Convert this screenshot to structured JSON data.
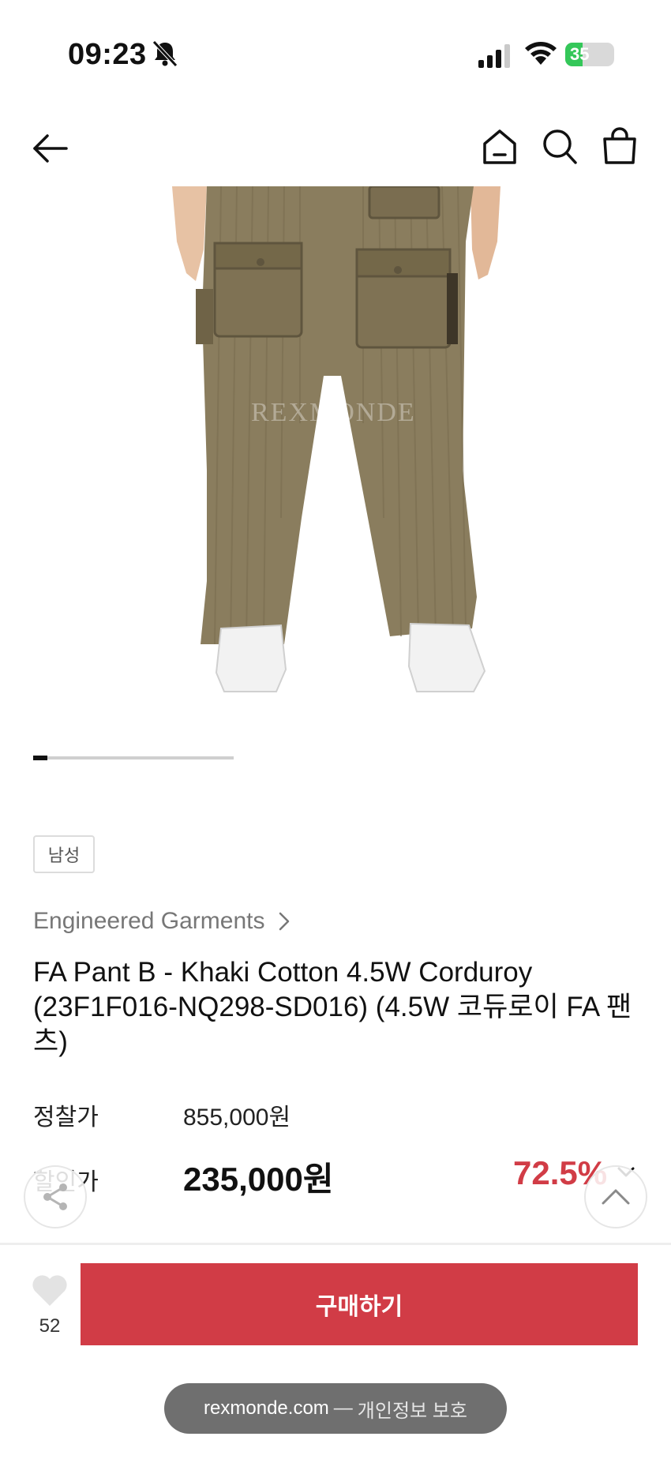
{
  "status_bar": {
    "time": "09:23",
    "battery_level": "35",
    "battery_fill_fraction": 0.35
  },
  "header": {
    "icons": [
      "back-arrow-icon",
      "home-icon",
      "search-icon",
      "shopping-bag-icon"
    ]
  },
  "product_image": {
    "watermark": "REXMONDE",
    "carousel_position": 1
  },
  "product": {
    "gender_tag": "남성",
    "brand": "Engineered Garments",
    "title": "FA Pant B - Khaki Cotton 4.5W Corduroy (23F1F016-NQ298-SD016) (4.5W 코듀로이 FA 팬츠)",
    "list_price_label": "정찰가",
    "list_price": "855,000원",
    "sale_price_label": "할인가",
    "sale_price": "235,000원",
    "discount_rate": "72.5%"
  },
  "actions": {
    "like_count": "52",
    "buy_label": "구매하기"
  },
  "browser": {
    "domain": "rexmonde.com",
    "separator": "—",
    "privacy_label": "개인정보 보호"
  },
  "colors": {
    "accent": "#d13c46",
    "pants": "#8a7d5e",
    "battery": "#34c759"
  }
}
